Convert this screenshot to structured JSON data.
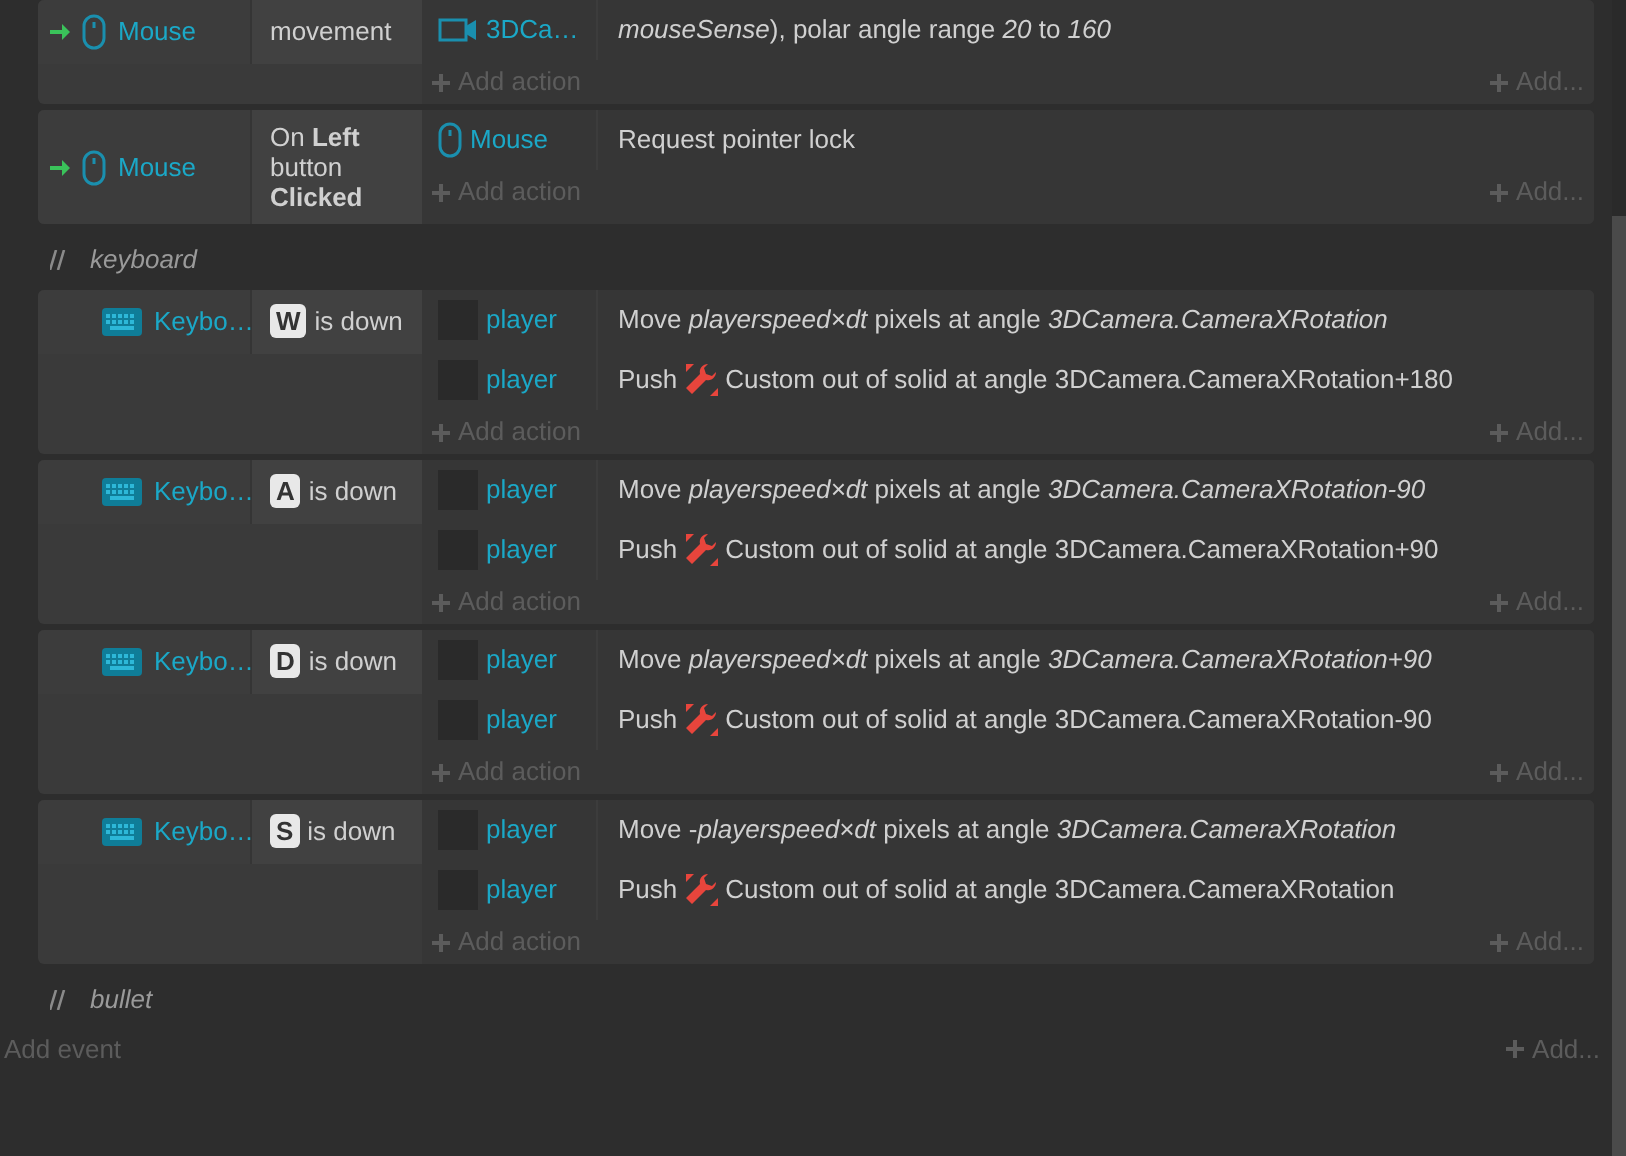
{
  "events": [
    {
      "kind": "event",
      "trigger": true,
      "object": {
        "kind": "mouse",
        "name": "Mouse"
      },
      "condition": {
        "text": "movement"
      },
      "actions": [
        {
          "object": {
            "kind": "camera",
            "name": "3DCa…"
          },
          "segments": [
            {
              "kind": "text",
              "text": "*mouseSense*), polar angle range *20* to *160*"
            }
          ]
        }
      ],
      "add_action": "Add action",
      "add_more": "Add..."
    },
    {
      "kind": "event",
      "trigger": true,
      "object": {
        "kind": "mouse",
        "name": "Mouse"
      },
      "condition": {
        "text": "On **Left** button **Clicked**"
      },
      "actions": [
        {
          "object": {
            "kind": "mouse",
            "name": "Mouse"
          },
          "segments": [
            {
              "kind": "text",
              "text": "Request pointer lock"
            }
          ]
        }
      ],
      "add_action": "Add action",
      "add_more": "Add..."
    },
    {
      "kind": "comment",
      "text": "keyboard"
    },
    {
      "kind": "event",
      "trigger": false,
      "object": {
        "kind": "keyboard",
        "name": "Keybo…"
      },
      "condition": {
        "key": "W",
        "text": "is down"
      },
      "actions": [
        {
          "object": {
            "kind": "blank",
            "name": "player"
          },
          "segments": [
            {
              "kind": "text",
              "text": "Move *playerspeed×dt* pixels at angle *3DCamera.CameraXRotation*"
            }
          ]
        },
        {
          "object": {
            "kind": "blank",
            "name": "player"
          },
          "segments": [
            {
              "kind": "text",
              "text": "Push"
            },
            {
              "kind": "wrench"
            },
            {
              "kind": "text",
              "text": "Custom out of solid at angle 3DCamera.CameraXRotation+180"
            }
          ]
        }
      ],
      "add_action": "Add action",
      "add_more": "Add..."
    },
    {
      "kind": "event",
      "trigger": false,
      "object": {
        "kind": "keyboard",
        "name": "Keybo…"
      },
      "condition": {
        "key": "A",
        "text": "is down"
      },
      "actions": [
        {
          "object": {
            "kind": "blank",
            "name": "player"
          },
          "segments": [
            {
              "kind": "text",
              "text": "Move *playerspeed×dt* pixels at angle *3DCamera.CameraXRotation-90*"
            }
          ]
        },
        {
          "object": {
            "kind": "blank",
            "name": "player"
          },
          "segments": [
            {
              "kind": "text",
              "text": "Push"
            },
            {
              "kind": "wrench"
            },
            {
              "kind": "text",
              "text": "Custom out of solid at angle 3DCamera.CameraXRotation+90"
            }
          ]
        }
      ],
      "add_action": "Add action",
      "add_more": "Add..."
    },
    {
      "kind": "event",
      "trigger": false,
      "object": {
        "kind": "keyboard",
        "name": "Keybo…"
      },
      "condition": {
        "key": "D",
        "text": "is down"
      },
      "actions": [
        {
          "object": {
            "kind": "blank",
            "name": "player"
          },
          "segments": [
            {
              "kind": "text",
              "text": "Move *playerspeed×dt* pixels at angle *3DCamera.CameraXRotation+90*"
            }
          ]
        },
        {
          "object": {
            "kind": "blank",
            "name": "player"
          },
          "segments": [
            {
              "kind": "text",
              "text": "Push"
            },
            {
              "kind": "wrench"
            },
            {
              "kind": "text",
              "text": "Custom out of solid at angle 3DCamera.CameraXRotation-90"
            }
          ]
        }
      ],
      "add_action": "Add action",
      "add_more": "Add..."
    },
    {
      "kind": "event",
      "trigger": false,
      "object": {
        "kind": "keyboard",
        "name": "Keybo…"
      },
      "condition": {
        "key": "S",
        "text": "is down"
      },
      "actions": [
        {
          "object": {
            "kind": "blank",
            "name": "player"
          },
          "segments": [
            {
              "kind": "text",
              "text": "Move -*playerspeed×dt* pixels at angle *3DCamera.CameraXRotation*"
            }
          ]
        },
        {
          "object": {
            "kind": "blank",
            "name": "player"
          },
          "segments": [
            {
              "kind": "text",
              "text": "Push"
            },
            {
              "kind": "wrench"
            },
            {
              "kind": "text",
              "text": "Custom out of solid at angle 3DCamera.CameraXRotation"
            }
          ]
        }
      ],
      "add_action": "Add action",
      "add_more": "Add..."
    },
    {
      "kind": "comment",
      "text": "bullet"
    }
  ],
  "footer": {
    "add_event": "Add event",
    "add_more": "Add..."
  }
}
